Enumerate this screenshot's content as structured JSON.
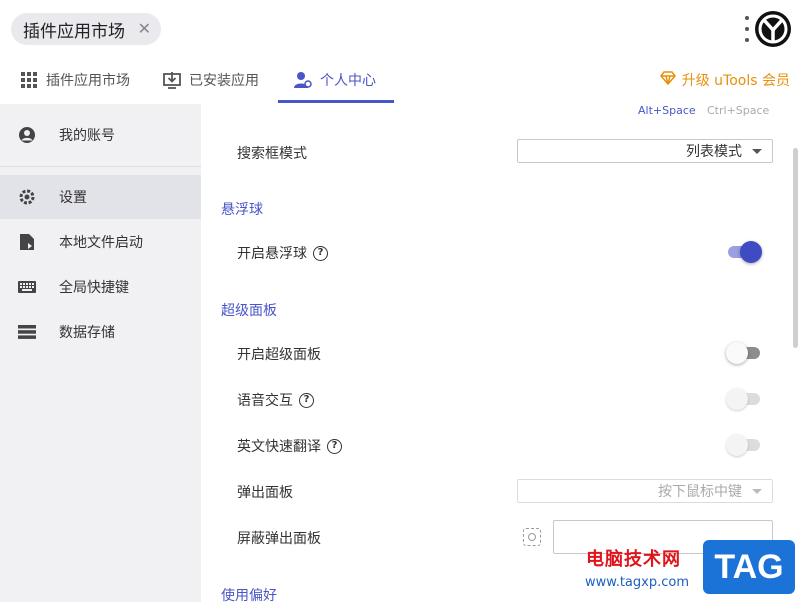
{
  "window": {
    "tab_title": "插件应用市场",
    "close_symbol": "✕"
  },
  "tabs": [
    {
      "label": "插件应用市场",
      "icon": "grid-icon"
    },
    {
      "label": "已安装应用",
      "icon": "download-icon"
    },
    {
      "label": "个人中心",
      "icon": "user-gear-icon",
      "active": true
    }
  ],
  "upgrade": {
    "label": "升级 uTools 会员",
    "icon": "diamond-icon",
    "color": "#e8900a"
  },
  "sidebar": {
    "items": [
      {
        "label": "我的账号",
        "icon": "account-icon"
      },
      {
        "label": "设置",
        "icon": "gear-icon",
        "active": true
      },
      {
        "label": "本地文件启动",
        "icon": "file-launch-icon"
      },
      {
        "label": "全局快捷键",
        "icon": "keyboard-icon"
      },
      {
        "label": "数据存储",
        "icon": "storage-icon"
      }
    ]
  },
  "content": {
    "hotkeys": [
      "Alt+Space",
      "Ctrl+Space"
    ],
    "search_mode": {
      "label": "搜索框模式",
      "value": "列表模式"
    },
    "floating_ball": {
      "title": "悬浮球",
      "enable": {
        "label": "开启悬浮球",
        "help": "?",
        "state": "on"
      }
    },
    "super_panel": {
      "title": "超级面板",
      "enable": {
        "label": "开启超级面板",
        "state": "off"
      },
      "voice": {
        "label": "语音交互",
        "help": "?",
        "state": "off-disabled"
      },
      "translate": {
        "label": "英文快速翻译",
        "help": "?",
        "state": "off-disabled"
      },
      "popup": {
        "label": "弹出面板",
        "value": "按下鼠标中键"
      },
      "block": {
        "label": "屏蔽弹出面板",
        "value": ""
      }
    },
    "preferences": {
      "title": "使用偏好"
    }
  },
  "colors": {
    "accent": "#4a55c8",
    "sidebar_bg": "#f1f1f4",
    "toggle_on": "#3f4bc2"
  },
  "watermark": {
    "line1": "电脑技术网",
    "line2": "www.tagxp.com",
    "badge": "TAG"
  }
}
